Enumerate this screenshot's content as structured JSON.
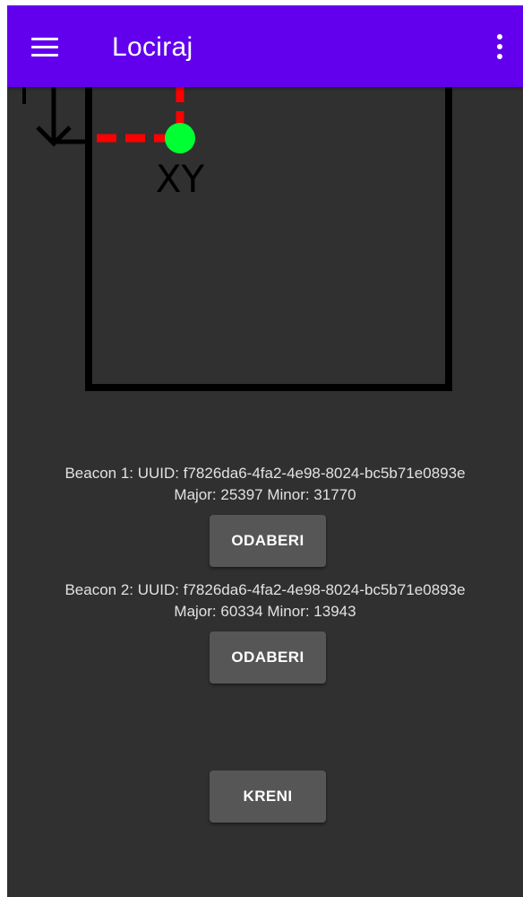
{
  "app_bar": {
    "title": "Lociraj",
    "background_color": "#6200ee",
    "menu_icon": "hamburger-menu-icon",
    "overflow_icon": "more-vert-icon"
  },
  "map": {
    "position_label": "XY",
    "marker_color": "#00ff33",
    "guide_line_color": "#ff0000",
    "wall_color": "#000000"
  },
  "beacons": [
    {
      "label": "Beacon 1: UUID: f7826da6-4fa2-4e98-8024-bc5b71e0893e",
      "details": "Major: 25397 Minor: 31770",
      "button_label": "ODABERI"
    },
    {
      "label": "Beacon 2: UUID: f7826da6-4fa2-4e98-8024-bc5b71e0893e",
      "details": "Major: 60334 Minor: 13943",
      "button_label": "ODABERI"
    }
  ],
  "start_button": {
    "label": "KRENI"
  },
  "colors": {
    "background": "#303030",
    "button": "#565656",
    "text": "#e2e2e2"
  }
}
